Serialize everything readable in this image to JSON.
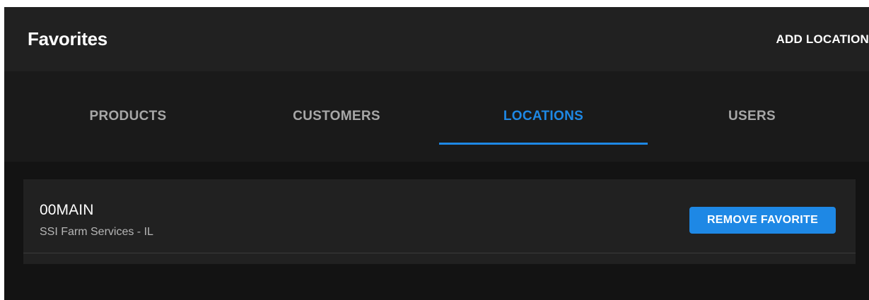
{
  "header": {
    "title": "Favorites",
    "add_location_label": "ADD LOCATION"
  },
  "tabs": [
    {
      "label": "PRODUCTS",
      "active": false
    },
    {
      "label": "CUSTOMERS",
      "active": false
    },
    {
      "label": "LOCATIONS",
      "active": true
    },
    {
      "label": "USERS",
      "active": false
    }
  ],
  "locations": [
    {
      "name": "00MAIN",
      "subtitle": "SSI Farm Services - IL",
      "action_label": "REMOVE FAVORITE"
    }
  ],
  "colors": {
    "accent": "#1e88e5",
    "background": "#131313",
    "surface": "#212121",
    "tab_inactive": "#a7a7a7"
  }
}
